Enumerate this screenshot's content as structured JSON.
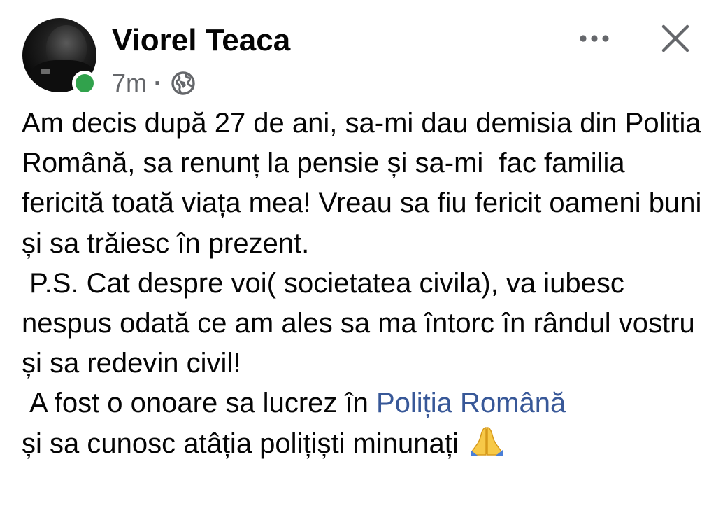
{
  "post": {
    "author": "Viorel Teaca",
    "time": "7m",
    "separator": "·",
    "privacy_icon": "globe-icon",
    "online": true,
    "online_color": "#31a24c",
    "actions": {
      "more_icon": "more-icon",
      "close_icon": "close-icon"
    },
    "text": {
      "paragraph_1": "Am decis după 27 de ani, sa-mi dau demisia din Politia Română, sa renunț la pensie și sa-mi  fac familia fericită toată viața mea! Vreau sa fiu fericit oameni buni și sa trăiesc în prezent.",
      "paragraph_2": " P.S. Cat despre voi( societatea civila), va iubesc nespus odată ce am ales sa ma întorc în rândul vostru și sa redevin civil!",
      "paragraph_3_before": " A fost o onoare sa lucrez în ",
      "paragraph_3_link": "Poliția Română",
      "paragraph_3_after": "și sa cunosc atâția polițiști minunați ",
      "emoji": "folded-hands-emoji"
    },
    "colors": {
      "link": "#385898",
      "meta": "#65676b",
      "text": "#050505"
    }
  }
}
